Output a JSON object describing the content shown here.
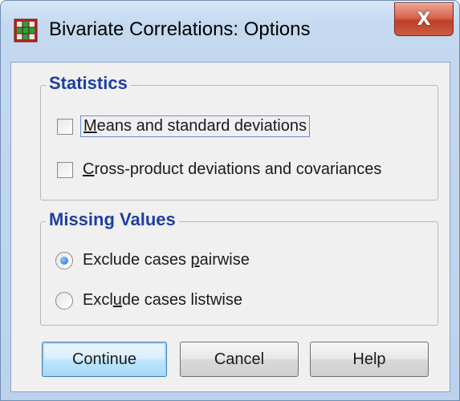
{
  "window": {
    "title": "Bivariate Correlations: Options",
    "close_glyph": "X"
  },
  "statistics": {
    "legend": "Statistics",
    "options": [
      {
        "mnemonic": "M",
        "rest": "eans and standard deviations",
        "checked": false,
        "focused": true
      },
      {
        "mnemonic": "C",
        "rest": "ross-product deviations and covariances",
        "checked": false,
        "focused": false
      }
    ]
  },
  "missing_values": {
    "legend": "Missing Values",
    "options": [
      {
        "before": "Exclude cases ",
        "mnemonic": "p",
        "after": "airwise",
        "selected": true
      },
      {
        "before": "Excl",
        "mnemonic": "u",
        "after": "de cases listwise",
        "selected": false
      }
    ]
  },
  "buttons": {
    "continue": "Continue",
    "cancel": "Cancel",
    "help": "Help"
  },
  "colors": {
    "legend_text": "#1f3f9f",
    "radio_fill": "#1f6fd0",
    "close_button": "#c0402a"
  }
}
